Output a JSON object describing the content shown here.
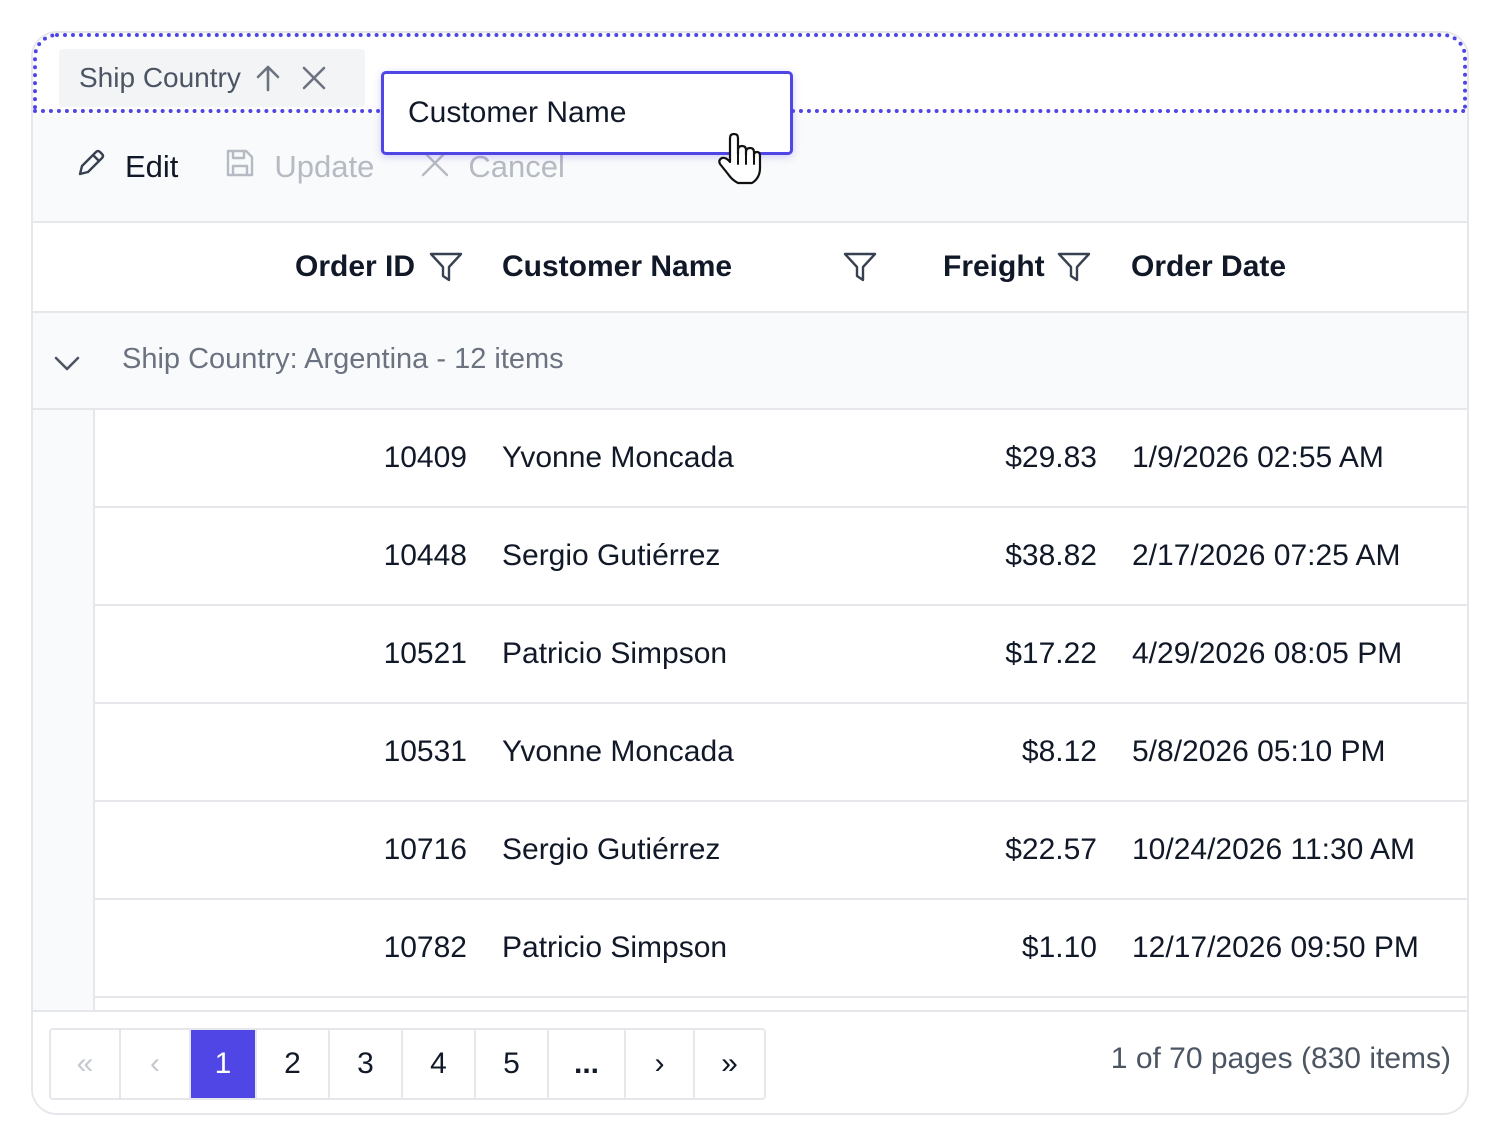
{
  "group_panel": {
    "chip_label": "Ship Country",
    "sort_icon": "arrow-up-icon",
    "remove_icon": "close-icon"
  },
  "drag_ghost": {
    "label": "Customer Name",
    "cursor_icon": "hand-pointer-icon"
  },
  "toolbar": {
    "edit_label": "Edit",
    "update_label": "Update",
    "cancel_label": "Cancel"
  },
  "columns": {
    "order_id": "Order ID",
    "customer_name": "Customer Name",
    "freight": "Freight",
    "order_date": "Order Date"
  },
  "group_row": {
    "label": "Ship Country: Argentina - 12 items"
  },
  "rows": [
    {
      "order_id": "10409",
      "customer_name": "Yvonne Moncada",
      "freight": "$29.83",
      "order_date": "1/9/2026 02:55 AM"
    },
    {
      "order_id": "10448",
      "customer_name": "Sergio Gutiérrez",
      "freight": "$38.82",
      "order_date": "2/17/2026 07:25 AM"
    },
    {
      "order_id": "10521",
      "customer_name": "Patricio Simpson",
      "freight": "$17.22",
      "order_date": "4/29/2026 08:05 PM"
    },
    {
      "order_id": "10531",
      "customer_name": "Yvonne Moncada",
      "freight": "$8.12",
      "order_date": "5/8/2026 05:10 PM"
    },
    {
      "order_id": "10716",
      "customer_name": "Sergio Gutiérrez",
      "freight": "$22.57",
      "order_date": "10/24/2026 11:30 AM"
    },
    {
      "order_id": "10782",
      "customer_name": "Patricio Simpson",
      "freight": "$1.10",
      "order_date": "12/17/2026 09:50 PM"
    }
  ],
  "pager": {
    "first": "«",
    "prev": "‹",
    "pages": [
      "1",
      "2",
      "3",
      "4",
      "5"
    ],
    "ellipsis": "...",
    "next": "›",
    "last": "»",
    "info": "1 of 70 pages (830 items)"
  },
  "colors": {
    "accent": "#4f46e5",
    "border": "#e5e7eb",
    "muted_bg": "#f9fafb"
  }
}
